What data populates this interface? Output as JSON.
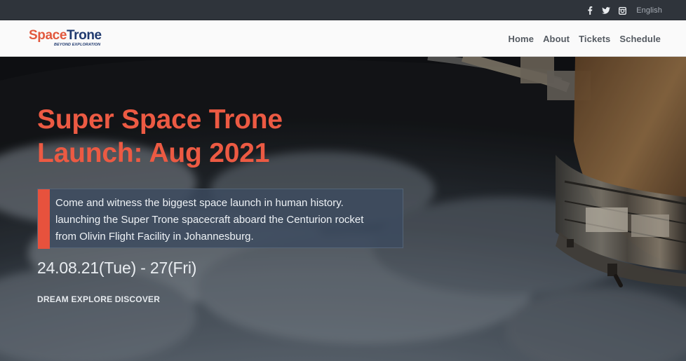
{
  "topbar": {
    "social": [
      {
        "icon": "facebook-icon"
      },
      {
        "icon": "twitter-icon"
      },
      {
        "icon": "instagram-icon"
      }
    ],
    "language": "English"
  },
  "brand": {
    "name_part1": "Space",
    "name_part2": "Trone",
    "tagline": "BEYOND EXPLORATION",
    "colors": {
      "accent": "#e2583d",
      "brand": "#203a6f"
    }
  },
  "nav": {
    "items": [
      "Home",
      "About",
      "Tickets",
      "Schedule"
    ]
  },
  "hero": {
    "title_line1": "Super Space Trone",
    "title_line2": "Launch: Aug 2021",
    "description_line1": "Come and witness the biggest space launch in human history.",
    "description_line2": "launching the Super Trone spacecraft aboard the Centurion rocket",
    "description_line3": "from Olivin Flight Facility in Johannesburg.",
    "date": "24.08.21(Tue) - 27(Fri)",
    "tagline": "DREAM EXPLORE DISCOVER",
    "colors": {
      "title": "#ec5a43",
      "accent_bar": "#e7523d"
    }
  }
}
